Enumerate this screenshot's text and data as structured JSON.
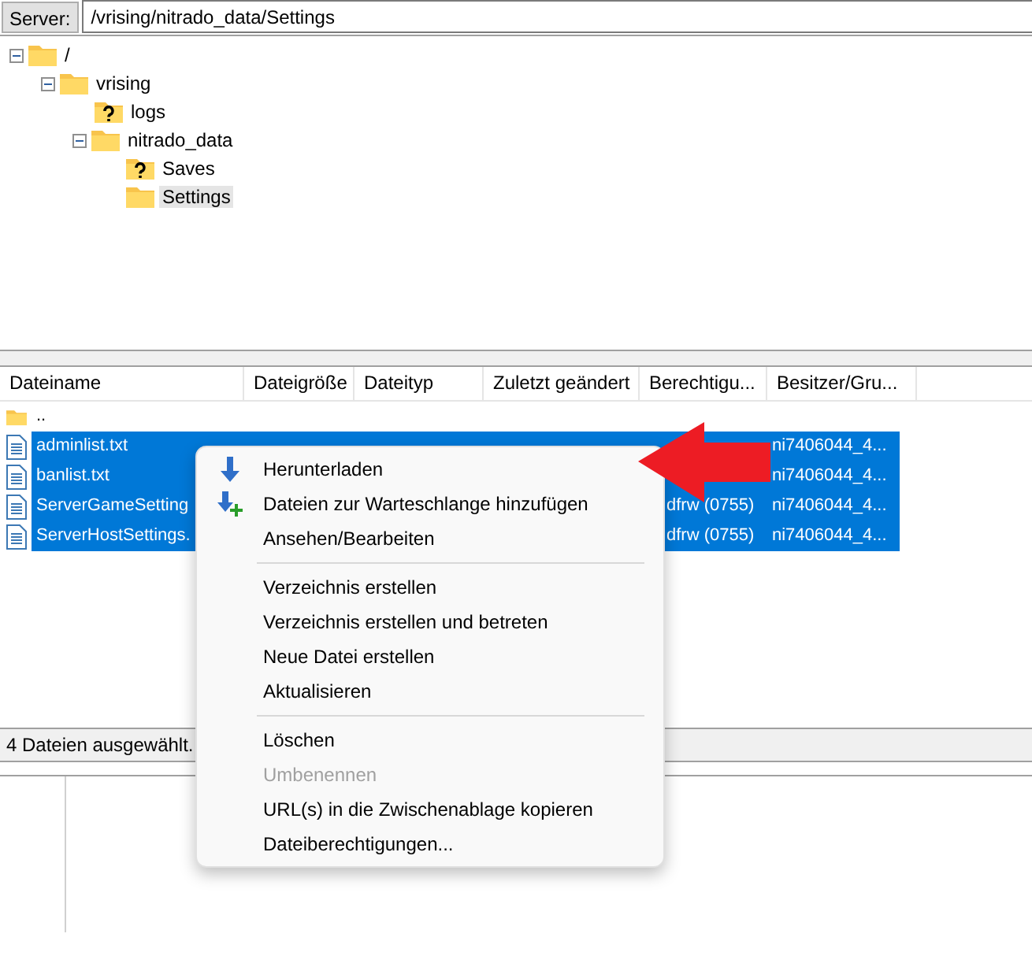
{
  "server_bar": {
    "label": "Server:",
    "path": "/vrising/nitrado_data/Settings"
  },
  "tree": [
    {
      "label": "/",
      "kind": "folder",
      "expanded": true,
      "selected": false,
      "children": [
        {
          "label": "vrising",
          "kind": "folder",
          "expanded": true,
          "selected": false,
          "children": [
            {
              "label": "logs",
              "kind": "unknown",
              "selected": false
            },
            {
              "label": "nitrado_data",
              "kind": "folder",
              "expanded": true,
              "selected": false,
              "children": [
                {
                  "label": "Saves",
                  "kind": "unknown",
                  "selected": false
                },
                {
                  "label": "Settings",
                  "kind": "folder",
                  "selected": true
                }
              ]
            }
          ]
        }
      ]
    }
  ],
  "file_list": {
    "columns": [
      "Dateiname",
      "Dateigröße",
      "Dateityp",
      "Zuletzt geändert",
      "Berechtigu...",
      "Besitzer/Gru..."
    ],
    "rows": [
      {
        "kind": "folder",
        "selected": false,
        "cells": [
          ".."
        ]
      },
      {
        "kind": "file",
        "selected": true,
        "cells": [
          "adminlist.txt",
          "",
          "",
          "",
          "",
          "ni7406044_4..."
        ]
      },
      {
        "kind": "file",
        "selected": true,
        "cells": [
          "banlist.txt",
          "",
          "",
          "",
          "",
          "ni7406044_4..."
        ]
      },
      {
        "kind": "file",
        "selected": true,
        "cells": [
          "ServerGameSetting",
          "",
          "",
          "",
          "dfrw (0755)",
          "ni7406044_4..."
        ]
      },
      {
        "kind": "file",
        "selected": true,
        "cells": [
          "ServerHostSettings.",
          "",
          "",
          "",
          "dfrw (0755)",
          "ni7406044_4..."
        ]
      }
    ]
  },
  "status_bar": "4 Dateien ausgewählt.",
  "context_menu": [
    {
      "kind": "item",
      "label": "Herunterladen",
      "disabled": false
    },
    {
      "kind": "item",
      "label": "Dateien zur Warteschlange hinzufügen",
      "disabled": false
    },
    {
      "kind": "item",
      "label": "Ansehen/Bearbeiten",
      "disabled": false
    },
    {
      "kind": "separator"
    },
    {
      "kind": "item",
      "label": "Verzeichnis erstellen",
      "disabled": false
    },
    {
      "kind": "item",
      "label": "Verzeichnis erstellen und betreten",
      "disabled": false
    },
    {
      "kind": "item",
      "label": "Neue Datei erstellen",
      "disabled": false
    },
    {
      "kind": "item",
      "label": "Aktualisieren",
      "disabled": false
    },
    {
      "kind": "separator"
    },
    {
      "kind": "item",
      "label": "Löschen",
      "disabled": false
    },
    {
      "kind": "item",
      "label": "Umbenennen",
      "disabled": true
    },
    {
      "kind": "item",
      "label": "URL(s) in die Zwischenablage kopieren",
      "disabled": false
    },
    {
      "kind": "item",
      "label": "Dateiberechtigungen...",
      "disabled": false
    }
  ]
}
